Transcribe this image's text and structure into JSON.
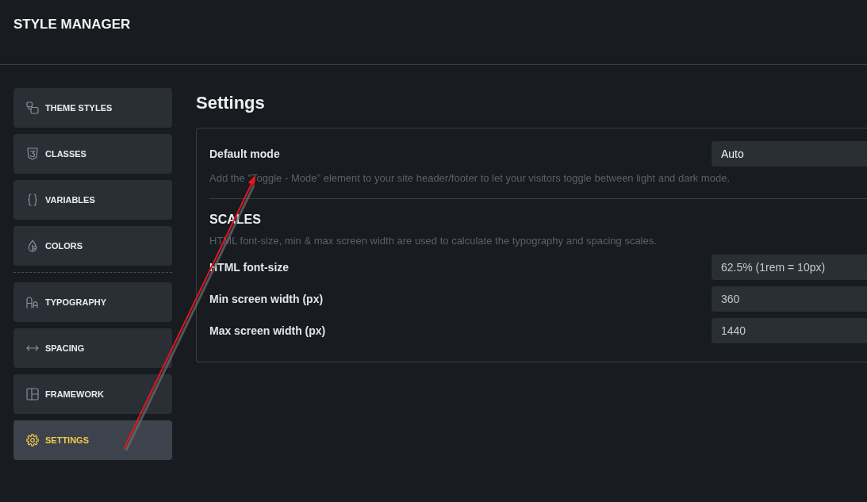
{
  "header": {
    "title": "STYLE MANAGER"
  },
  "sidebar": {
    "groups": [
      {
        "items": [
          {
            "label": "THEME STYLES",
            "selected": false
          },
          {
            "label": "CLASSES",
            "selected": false
          },
          {
            "label": "VARIABLES",
            "selected": false
          },
          {
            "label": "COLORS",
            "selected": false
          }
        ]
      },
      {
        "items": [
          {
            "label": "TYPOGRAPHY",
            "selected": false
          },
          {
            "label": "SPACING",
            "selected": false
          },
          {
            "label": "FRAMEWORK",
            "selected": false
          },
          {
            "label": "SETTINGS",
            "selected": true
          }
        ]
      }
    ]
  },
  "page": {
    "title": "Settings"
  },
  "settings_panel": {
    "sections": [
      {
        "fields": [
          {
            "kind": "select",
            "label": "Default mode",
            "value": "Auto",
            "hint": "Add the \"Toggle - Mode\" element to your site header/footer to let your visitors toggle between light and dark mode."
          }
        ]
      },
      {
        "heading": "SCALES",
        "description": "HTML font-size, min & max screen width are used to calculate the typography and spacing scales.",
        "fields": [
          {
            "kind": "input",
            "label": "HTML font-size",
            "value": "62.5% (1rem = 10px)"
          },
          {
            "kind": "input",
            "label": "Min screen width (px)",
            "value": "360"
          },
          {
            "kind": "input",
            "label": "Max screen width (px)",
            "value": "1440"
          }
        ]
      }
    ]
  },
  "annotations": [
    {
      "kind": "arrow"
    }
  ]
}
